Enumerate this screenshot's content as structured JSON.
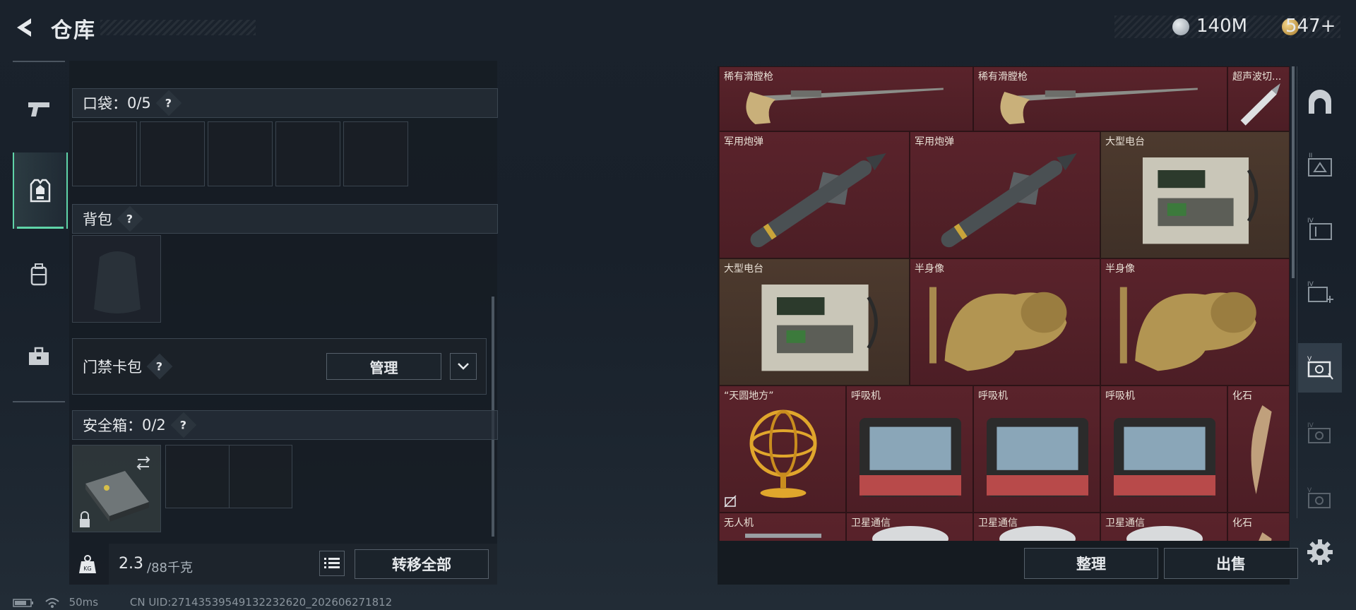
{
  "header": {
    "title": "仓库"
  },
  "currency": {
    "silver": "140M",
    "gold": "547+"
  },
  "nav": {
    "items": [
      "weapon-icon",
      "equipment-icon",
      "backpack-icon",
      "toolbox-icon"
    ],
    "active": 1
  },
  "pocket": {
    "label": "口袋：",
    "count": "0/5",
    "help": "?"
  },
  "backpack": {
    "label": "背包",
    "help": "?"
  },
  "keycard": {
    "label": "门禁卡包",
    "help": "?",
    "manage": "管理"
  },
  "safebox": {
    "label": "安全箱：",
    "count": "0/2",
    "help": "?"
  },
  "weight": {
    "current": "2.3",
    "max": "/88千克"
  },
  "actions": {
    "transfer_all": "转移全部",
    "sort": "整理",
    "sell": "出售"
  },
  "status": {
    "ping": "50ms",
    "uid": "CN UID:2714353954913223262‌0_202606271812"
  },
  "grid": {
    "items": [
      {
        "label": "稀有滑膛枪",
        "icon": "musket"
      },
      {
        "label": "稀有滑膛枪",
        "icon": "musket"
      },
      {
        "label": "超声波切...",
        "icon": "cutter"
      },
      {
        "label": "军用炮弹",
        "icon": "missile"
      },
      {
        "label": "军用炮弹",
        "icon": "missile"
      },
      {
        "label": "大型电台",
        "icon": "radio"
      },
      {
        "label": "大型电台",
        "icon": "radio"
      },
      {
        "label": "半身像",
        "icon": "bust"
      },
      {
        "label": "半身像",
        "icon": "bust"
      },
      {
        "label": "“天圆地方”",
        "icon": "armillary"
      },
      {
        "label": "呼吸机",
        "icon": "ventilator"
      },
      {
        "label": "呼吸机",
        "icon": "ventilator"
      },
      {
        "label": "呼吸机",
        "icon": "ventilator"
      },
      {
        "label": "化石",
        "icon": "fossil"
      },
      {
        "label": "无人机",
        "icon": "drone"
      },
      {
        "label": "卫星通信",
        "icon": "satellite"
      },
      {
        "label": "卫星通信",
        "icon": "satellite"
      },
      {
        "label": "卫星通信",
        "icon": "satellite"
      },
      {
        "label": "化石",
        "icon": "fossil"
      }
    ]
  },
  "rail": {
    "items": [
      "base-icon",
      "storage-1-icon",
      "storage-4-icon",
      "storage-add-icon",
      "storage-5-active-icon",
      "storage-iv-icon",
      "storage-v-icon"
    ],
    "settings": "gear-icon"
  }
}
